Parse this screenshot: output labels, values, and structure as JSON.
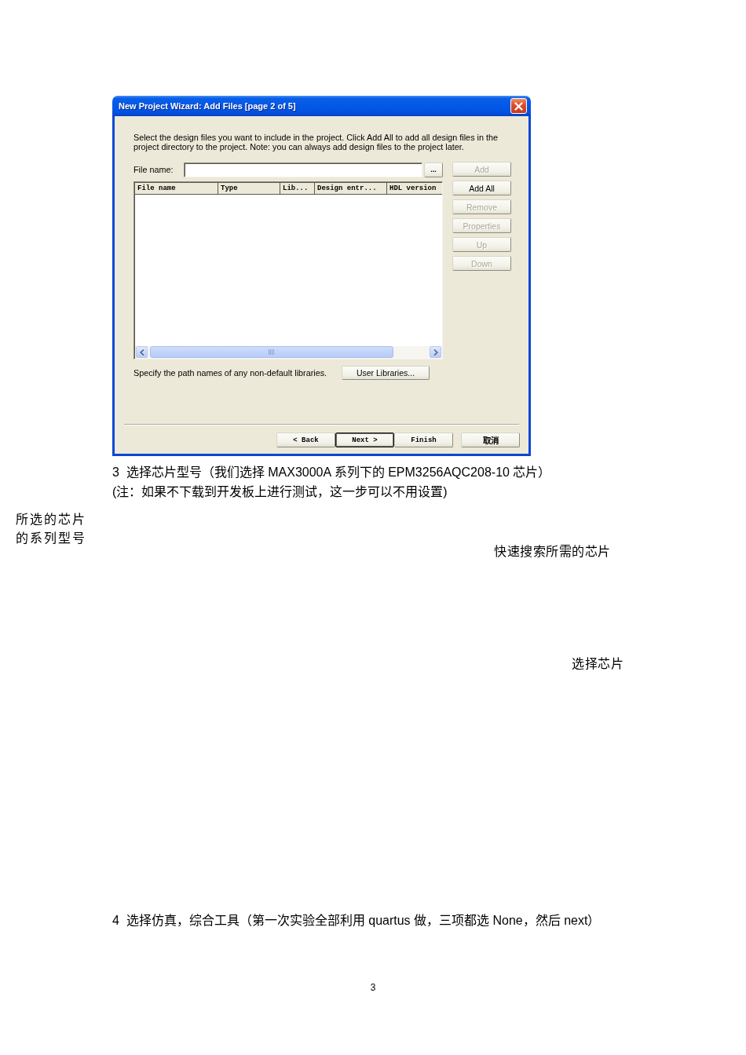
{
  "dialog": {
    "title": "New Project Wizard: Add Files [page 2 of 5]",
    "instructions": "Select the design files you want to include in the project. Click Add All to add all design files in the project directory to the project. Note: you can always add design files to the project later.",
    "file_name_label": "File name:",
    "browse_button": "...",
    "columns": [
      "File name",
      "Type",
      "Lib...",
      "Design entr...",
      "HDL version"
    ],
    "side_buttons": [
      {
        "label": "Add",
        "disabled": true
      },
      {
        "label": "Add All",
        "disabled": false
      },
      {
        "label": "Remove",
        "disabled": true
      },
      {
        "label": "Properties",
        "disabled": true
      },
      {
        "label": "Up",
        "disabled": true
      },
      {
        "label": "Down",
        "disabled": true
      }
    ],
    "library_hint": "Specify the path names of any non-default libraries.",
    "library_button": "User Libraries...",
    "nav_buttons": [
      {
        "label": "< Back",
        "default": false
      },
      {
        "label": "Next >",
        "default": true
      },
      {
        "label": "Finish",
        "default": false
      },
      {
        "label": "取消",
        "default": false
      }
    ]
  },
  "step_3": {
    "heading": "3  选择芯片型号（我们选择 MAX3000A 系列下的 EPM3256AQC208-10 芯片）",
    "note": "(注：如果不下载到开发板上进行测试，这一步可以不用设置)"
  },
  "annotations": [
    {
      "text": "所选的芯片的系列型号"
    },
    {
      "text": "快速搜索所需的芯片"
    },
    {
      "text": "选择芯片"
    }
  ],
  "step_4": {
    "heading": "4  选择仿真，综合工具（第一次实验全部利用 quartus 做，三项都选 None，然后 next）"
  },
  "page_number": "3"
}
